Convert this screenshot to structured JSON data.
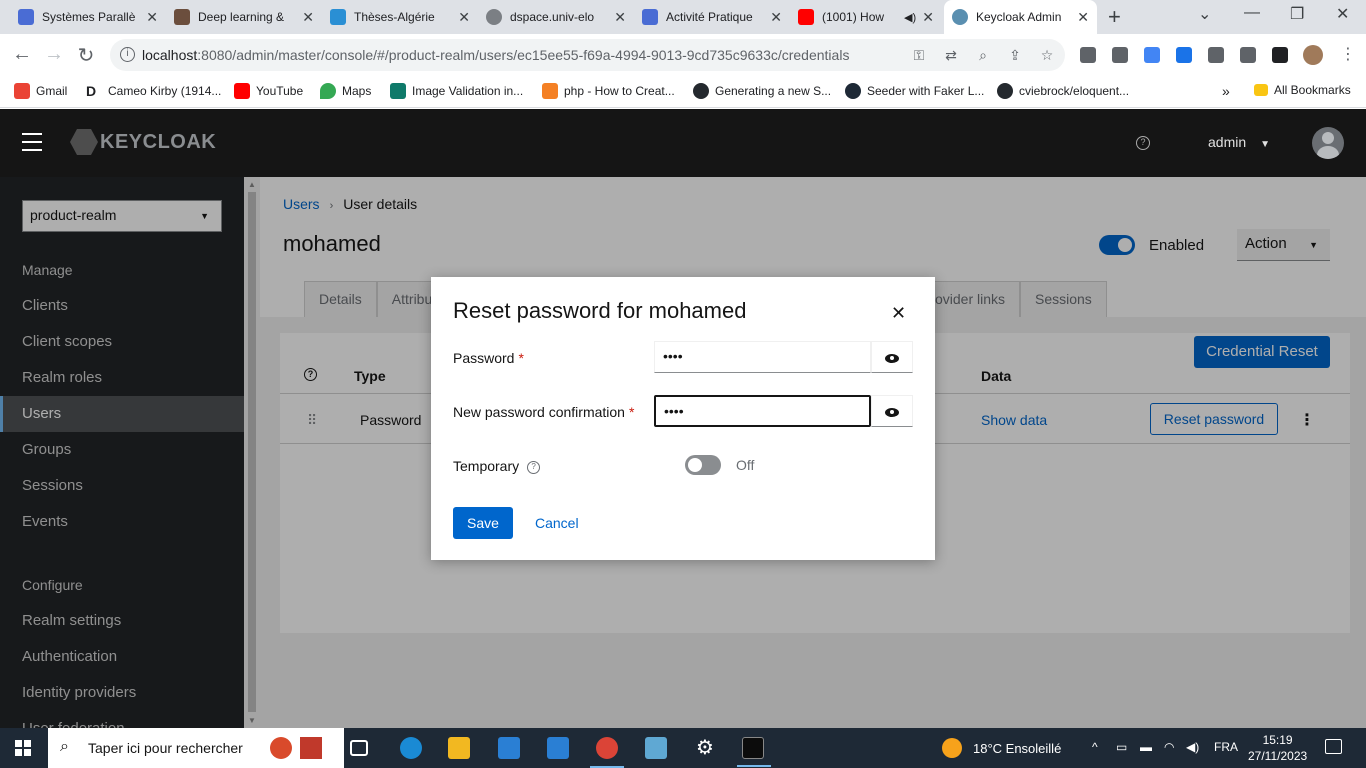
{
  "browser": {
    "tabs": [
      {
        "title": "Systèmes Parallè",
        "color": "#4a6cd4"
      },
      {
        "title": "Deep learning &",
        "color": "#6b4e3d"
      },
      {
        "title": "Thèses-Algérie",
        "color": "#2a8fd4"
      },
      {
        "title": "dspace.univ-elo",
        "color": "#7b7f84"
      },
      {
        "title": "Activité Pratique",
        "color": "#4a6cd4"
      },
      {
        "title": "(1001) How",
        "color": "#ff0000"
      },
      {
        "title": "Keycloak Admin",
        "color": "#5a8fb0"
      }
    ],
    "url_host": "localhost",
    "url_path": ":8080/admin/master/console/#/product-realm/users/ec15ee55-f69a-4994-9013-9cd735c9633c/credentials",
    "bookmarks": [
      {
        "label": "Gmail",
        "color": "#ea4335"
      },
      {
        "label": "Cameo Kirby (1914...",
        "color": "#ffffff"
      },
      {
        "label": "YouTube",
        "color": "#ff0000"
      },
      {
        "label": "Maps",
        "color": "#34a853"
      },
      {
        "label": "Image Validation in...",
        "color": "#0f7a6a"
      },
      {
        "label": "php - How to Creat...",
        "color": "#f48024"
      },
      {
        "label": "Generating a new S...",
        "color": "#24292e"
      },
      {
        "label": "Seeder with Faker L...",
        "color": "#1e2936"
      },
      {
        "label": "cviebrock/eloquent...",
        "color": "#24292e"
      }
    ],
    "all_bookmarks": "All Bookmarks"
  },
  "header": {
    "logo": "KEYCLOAK",
    "user": "admin"
  },
  "sidebar": {
    "realm": "product-realm",
    "manage_label": "Manage",
    "manage_items": [
      "Clients",
      "Client scopes",
      "Realm roles",
      "Users",
      "Groups",
      "Sessions",
      "Events"
    ],
    "configure_label": "Configure",
    "configure_items": [
      "Realm settings",
      "Authentication",
      "Identity providers",
      "User federation"
    ]
  },
  "page": {
    "breadcrumb": [
      "Users",
      "User details"
    ],
    "username": "mohamed",
    "enabled_label": "Enabled",
    "action_label": "Action",
    "tabs": [
      "Details",
      "Attribu",
      "ovider links",
      "Sessions"
    ],
    "credential_reset": "Credential Reset",
    "columns": {
      "type": "Type",
      "data": "Data"
    },
    "row": {
      "type": "Password",
      "data": "Show data",
      "reset": "Reset password"
    }
  },
  "modal": {
    "title": "Reset password for mohamed",
    "password_label": "Password",
    "password_value": "••••",
    "confirm_label": "New password confirmation",
    "confirm_value": "••••",
    "temporary_label": "Temporary",
    "temporary_state": "Off",
    "save": "Save",
    "cancel": "Cancel"
  },
  "taskbar": {
    "search_placeholder": "Taper ici pour rechercher",
    "weather": "18°C  Ensoleillé",
    "lang": "FRA",
    "time": "15:19",
    "date": "27/11/2023"
  }
}
